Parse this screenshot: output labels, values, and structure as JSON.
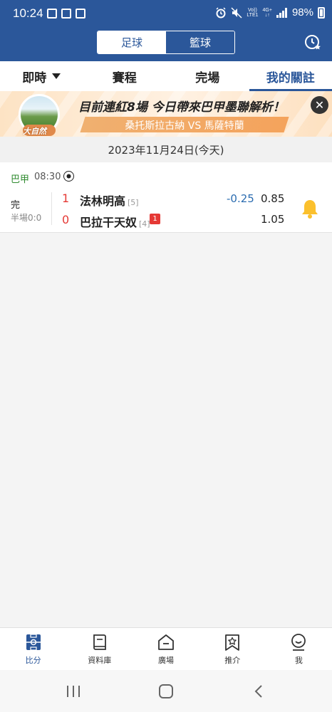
{
  "status_bar": {
    "time": "10:24",
    "battery": "98%",
    "net_top": "Vo))",
    "net_bottom": "LTE1",
    "gen_top": "4G+",
    "gen_bottom": "↓↑"
  },
  "sport_toggle": {
    "football": "足球",
    "basketball": "籃球",
    "selected": "football"
  },
  "tabs": [
    {
      "label": "即時",
      "active": false,
      "has_dropdown": true
    },
    {
      "label": "賽程",
      "active": false
    },
    {
      "label": "完場",
      "active": false
    },
    {
      "label": "我的關註",
      "active": true
    }
  ],
  "banner": {
    "avatar_label": "大自然",
    "title": "目前連紅8場 今日帶來巴甲墨聯解析！",
    "subtitle": "桑托斯拉古納 VS 馬薩特蘭",
    "close": "✕"
  },
  "date_header": "2023年11月24日(今天)",
  "match": {
    "league": "巴甲",
    "time": "08:30",
    "status": "完",
    "half_time": "半場0:0",
    "home": {
      "score": "1",
      "name": "法林明高",
      "rank": "[5]",
      "odds": "0.85"
    },
    "away": {
      "score": "0",
      "name": "巴拉干天奴",
      "rank": "[4]",
      "red_cards": "1",
      "odds": "1.05"
    },
    "handicap": "-0.25"
  },
  "bottom_nav": [
    {
      "label": "比分",
      "icon": "scoreboard-icon",
      "active": true
    },
    {
      "label": "資料庫",
      "icon": "book-icon",
      "active": false
    },
    {
      "label": "廣場",
      "icon": "plaza-icon",
      "active": false
    },
    {
      "label": "推介",
      "icon": "star-bookmark-icon",
      "active": false
    },
    {
      "label": "我",
      "icon": "profile-icon",
      "active": false
    }
  ],
  "colors": {
    "brand": "#2b579a",
    "score_red": "#e53935",
    "league_green": "#2e8a2e",
    "handicap_blue": "#2b6cb0",
    "bell_yellow": "#fbc02d"
  }
}
